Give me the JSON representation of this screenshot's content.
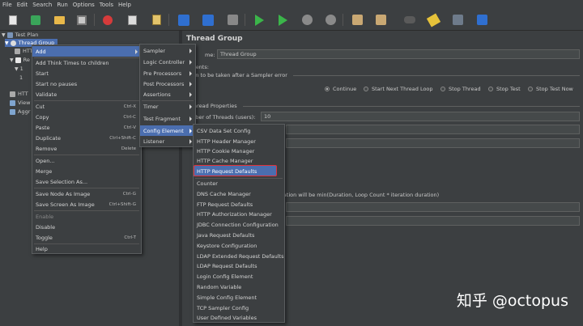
{
  "menubar": [
    "File",
    "Edit",
    "Search",
    "Run",
    "Options",
    "Tools",
    "Help"
  ],
  "tree": {
    "items": [
      {
        "label": "Test Plan"
      },
      {
        "label": "Thread Group"
      },
      {
        "label": "HTT"
      },
      {
        "label": "Re"
      },
      {
        "label": "1"
      },
      {
        "label": "1"
      },
      {
        "label": "HTT"
      },
      {
        "label": "View"
      },
      {
        "label": "Aggr"
      }
    ]
  },
  "main": {
    "title": "Thread Group",
    "name_label": "me:",
    "name_value": "Thread Group",
    "comments_label": "mments:",
    "action_label": "tion to be taken after a Sampler error",
    "radios": [
      {
        "label": "Continue",
        "selected": true
      },
      {
        "label": "Start Next Thread Loop",
        "selected": false
      },
      {
        "label": "Stop Thread",
        "selected": false
      },
      {
        "label": "Stop Test",
        "selected": false
      },
      {
        "label": "Stop Test Now",
        "selected": false
      }
    ],
    "props_label": "hread Properties",
    "threads_label": "mber of Threads (users):",
    "threads_value": "10",
    "duration_note": "uration will be min(Duration, Loop Count * iteration duration)"
  },
  "context_menu": {
    "items": [
      {
        "label": "Add",
        "submenu": true
      },
      {
        "label": "Add Think Times to children"
      },
      {
        "label": "Start"
      },
      {
        "label": "Start no pauses"
      },
      {
        "label": "Validate"
      },
      {
        "label": "Cut",
        "shortcut": "Ctrl-X"
      },
      {
        "label": "Copy",
        "shortcut": "Ctrl-C"
      },
      {
        "label": "Paste",
        "shortcut": "Ctrl-V"
      },
      {
        "label": "Duplicate",
        "shortcut": "Ctrl+Shift-C"
      },
      {
        "label": "Remove",
        "shortcut": "Delete"
      },
      {
        "label": "Open..."
      },
      {
        "label": "Merge"
      },
      {
        "label": "Save Selection As..."
      },
      {
        "label": "Save Node As Image",
        "shortcut": "Ctrl-G"
      },
      {
        "label": "Save Screen As Image",
        "shortcut": "Ctrl+Shift-G"
      },
      {
        "label": "Enable"
      },
      {
        "label": "Disable"
      },
      {
        "label": "Toggle",
        "shortcut": "Ctrl-T"
      },
      {
        "label": "Help"
      }
    ]
  },
  "add_menu": {
    "items": [
      {
        "label": "Sampler"
      },
      {
        "label": "Logic Controller"
      },
      {
        "label": "Pre Processors"
      },
      {
        "label": "Post Processors"
      },
      {
        "label": "Assertions"
      },
      {
        "label": "Timer"
      },
      {
        "label": "Test Fragment"
      },
      {
        "label": "Config Element"
      },
      {
        "label": "Listener"
      }
    ]
  },
  "config_menu": {
    "items": [
      "CSV Data Set Config",
      "HTTP Header Manager",
      "HTTP Cookie Manager",
      "HTTP Cache Manager",
      "HTTP Request Defaults",
      "Counter",
      "DNS Cache Manager",
      "FTP Request Defaults",
      "HTTP Authorization Manager",
      "JDBC Connection Configuration",
      "Java Request Defaults",
      "Keystore Configuration",
      "LDAP Extended Request Defaults",
      "LDAP Request Defaults",
      "Login Config Element",
      "Random Variable",
      "Simple Config Element",
      "TCP Sampler Config",
      "User Defined Variables"
    ]
  },
  "watermark": "知乎 @octopus",
  "colors": {
    "selection": "#4b6eaf",
    "highlight_border": "#e0323a",
    "background": "#3c3f41"
  }
}
